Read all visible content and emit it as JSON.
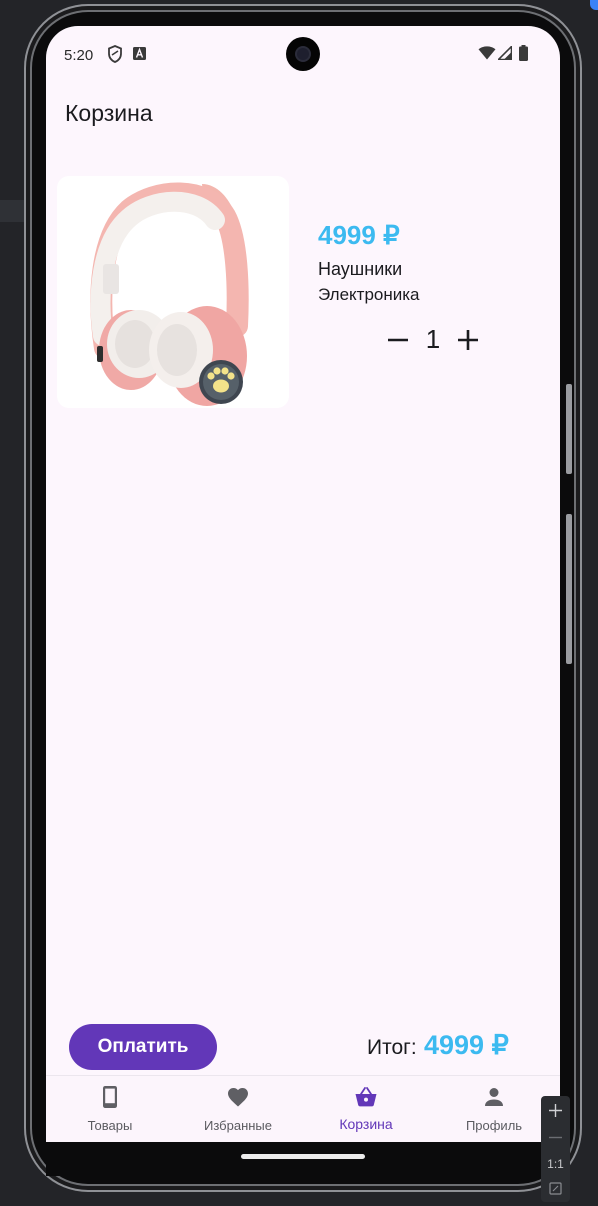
{
  "status_bar": {
    "time": "5:20",
    "icons": [
      "vpn-shield-icon",
      "font-a-icon",
      "wifi-icon",
      "signal-icon",
      "battery-icon"
    ]
  },
  "page": {
    "title": "Корзина"
  },
  "cart_item": {
    "image": "headphones-product-image",
    "price": "4999 ₽",
    "name": "Наушники",
    "category": "Электроника",
    "quantity": "1"
  },
  "footer": {
    "pay_label": "Оплатить",
    "total_label": "Итог:",
    "total_value": "4999 ₽"
  },
  "bottom_nav": {
    "items": [
      {
        "label": "Товары",
        "icon": "phone-icon",
        "active": false
      },
      {
        "label": "Избранные",
        "icon": "heart-icon",
        "active": false
      },
      {
        "label": "Корзина",
        "icon": "basket-icon",
        "active": true
      },
      {
        "label": "Профиль",
        "icon": "person-icon",
        "active": false
      }
    ]
  },
  "zoom_controls": {
    "ratio_label": "1:1"
  },
  "colors": {
    "accent": "#6237b8",
    "price": "#3cbaf0",
    "background": "#fdf6fd"
  }
}
